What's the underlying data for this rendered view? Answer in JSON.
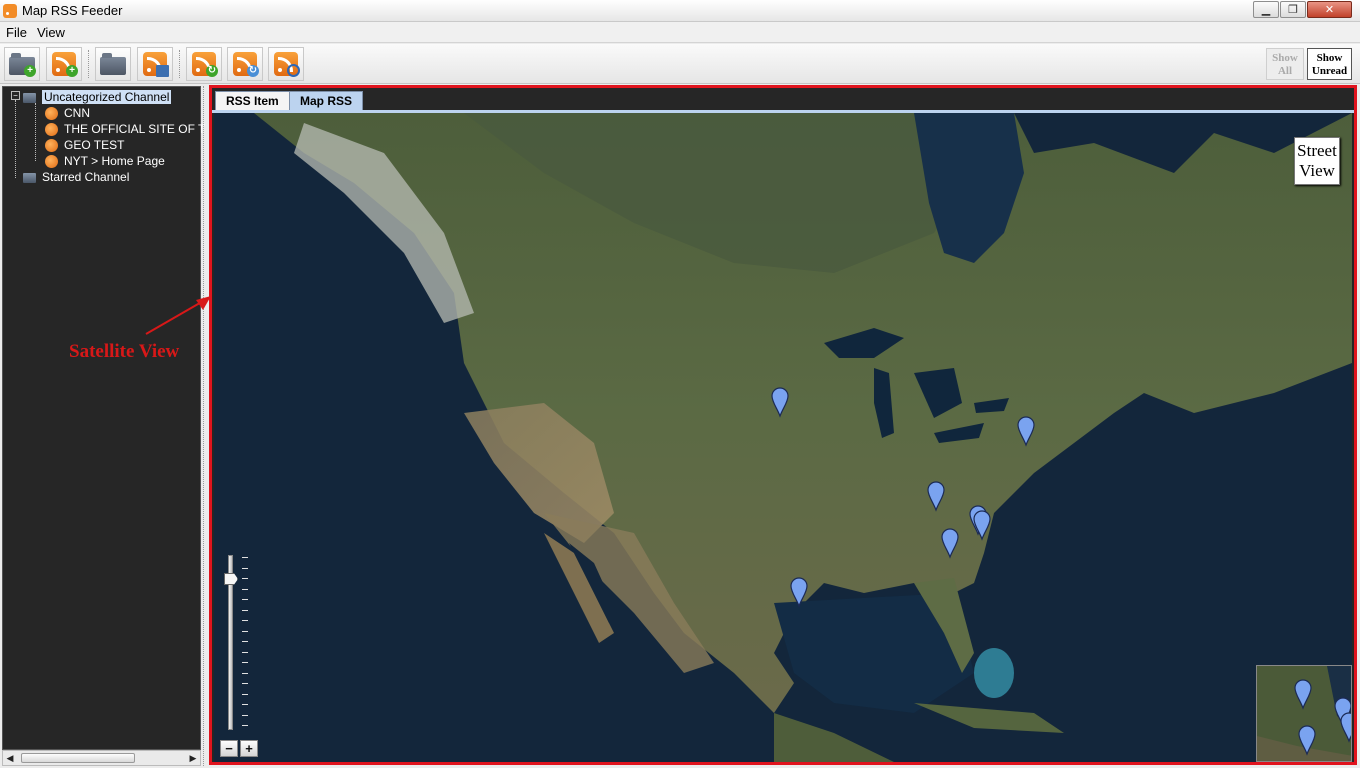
{
  "window": {
    "title": "Map RSS Feeder"
  },
  "menu": {
    "items": [
      "File",
      "View"
    ]
  },
  "toolbar": {
    "buttons": [
      {
        "name": "add-channel-button",
        "icon": "folder-add-icon"
      },
      {
        "name": "add-feed-button",
        "icon": "rss-add-icon"
      },
      {
        "name": "open-button",
        "icon": "folder-open-icon"
      },
      {
        "name": "save-button",
        "icon": "rss-save-icon"
      },
      {
        "name": "refresh-feed-button",
        "icon": "rss-refresh-icon"
      },
      {
        "name": "update-feed-button",
        "icon": "rss-update-icon"
      },
      {
        "name": "search-feed-button",
        "icon": "rss-search-icon"
      }
    ],
    "show_all_label": "Show All",
    "show_unread_label": "Show Unread"
  },
  "sidebar": {
    "channels": [
      {
        "label": "Uncategorized Channel",
        "selected": true,
        "expanded": true,
        "feeds": [
          "CNN",
          "THE OFFICIAL SITE OF T",
          "GEO TEST",
          "NYT > Home Page"
        ]
      },
      {
        "label": "Starred Channel",
        "selected": false
      }
    ]
  },
  "annotation": {
    "text": "Satellite View",
    "color": "#d81818"
  },
  "tabs": [
    {
      "label": "RSS Item",
      "active": false
    },
    {
      "label": "Map RSS",
      "active": true
    }
  ],
  "map": {
    "type": "satellite",
    "street_view_label": "Street View",
    "zoom_out_label": "−",
    "zoom_in_label": "+",
    "marker_count": 8,
    "marker_color": "#7aa3f0",
    "minimap_marker_count": 4
  },
  "colors": {
    "frame_border": "#e0141e",
    "rss_orange": "#f28c28",
    "tab_active": "#bcd3ef"
  }
}
